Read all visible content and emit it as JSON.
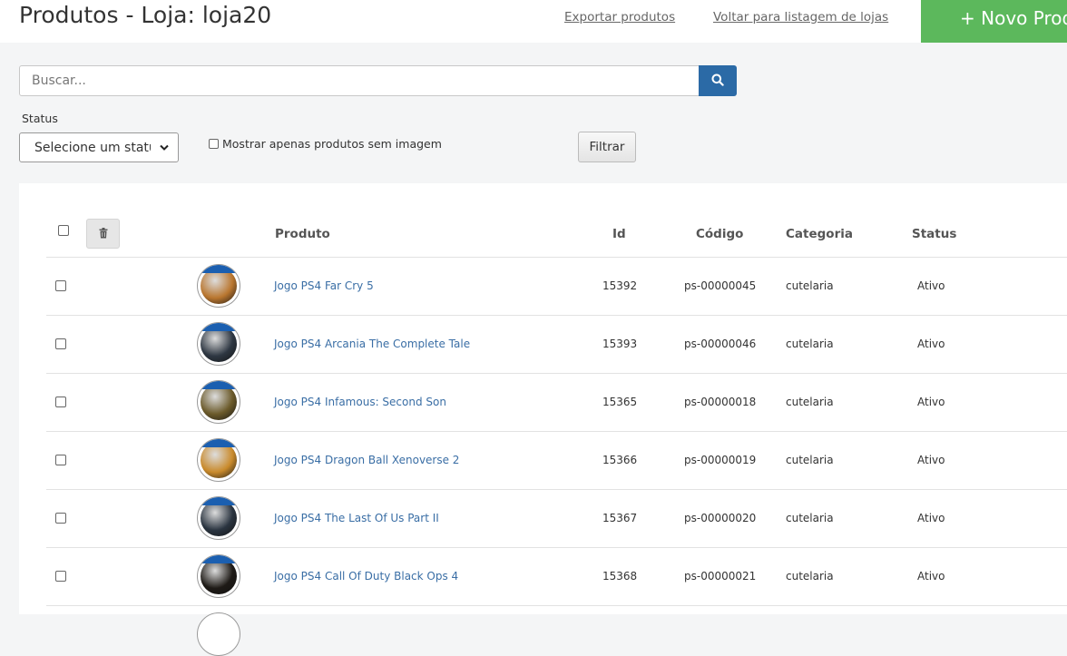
{
  "header": {
    "title": "Produtos - Loja: loja20",
    "export_link": "Exportar produtos",
    "back_link": "Voltar para listagem de lojas",
    "new_button": "+ Novo Prod"
  },
  "search": {
    "placeholder": "Buscar...",
    "value": ""
  },
  "filters": {
    "status_label": "Status",
    "status_selected": "Selecione um status",
    "no_image_label": "Mostrar apenas produtos sem imagem",
    "filter_button": "Filtrar"
  },
  "table": {
    "headers": {
      "product": "Produto",
      "id": "Id",
      "code": "Código",
      "category": "Categoria",
      "status": "Status"
    },
    "rows": [
      {
        "name": "Jogo PS4 Far Cry 5",
        "id": "15392",
        "code": "ps-00000045",
        "category": "cutelaria",
        "status": "Ativo",
        "thumb_color": "#b9762f"
      },
      {
        "name": "Jogo PS4 Arcania The Complete Tale",
        "id": "15393",
        "code": "ps-00000046",
        "category": "cutelaria",
        "status": "Ativo",
        "thumb_color": "#2e3742"
      },
      {
        "name": "Jogo PS4 Infamous: Second Son",
        "id": "15365",
        "code": "ps-00000018",
        "category": "cutelaria",
        "status": "Ativo",
        "thumb_color": "#6b5a2a"
      },
      {
        "name": "Jogo PS4 Dragon Ball Xenoverse 2",
        "id": "15366",
        "code": "ps-00000019",
        "category": "cutelaria",
        "status": "Ativo",
        "thumb_color": "#c98a2b"
      },
      {
        "name": "Jogo PS4 The Last Of Us Part II",
        "id": "15367",
        "code": "ps-00000020",
        "category": "cutelaria",
        "status": "Ativo",
        "thumb_color": "#2a3440"
      },
      {
        "name": "Jogo PS4 Call Of Duty Black Ops 4",
        "id": "15368",
        "code": "ps-00000021",
        "category": "cutelaria",
        "status": "Ativo",
        "thumb_color": "#1e1a16"
      }
    ]
  },
  "colors": {
    "accent_green": "#5cb85c",
    "search_blue": "#2b6aa6",
    "link_blue": "#3a6ea5"
  },
  "icons": {
    "search": "search-icon",
    "delete": "trash-icon",
    "select": "chevron-down-icon"
  }
}
